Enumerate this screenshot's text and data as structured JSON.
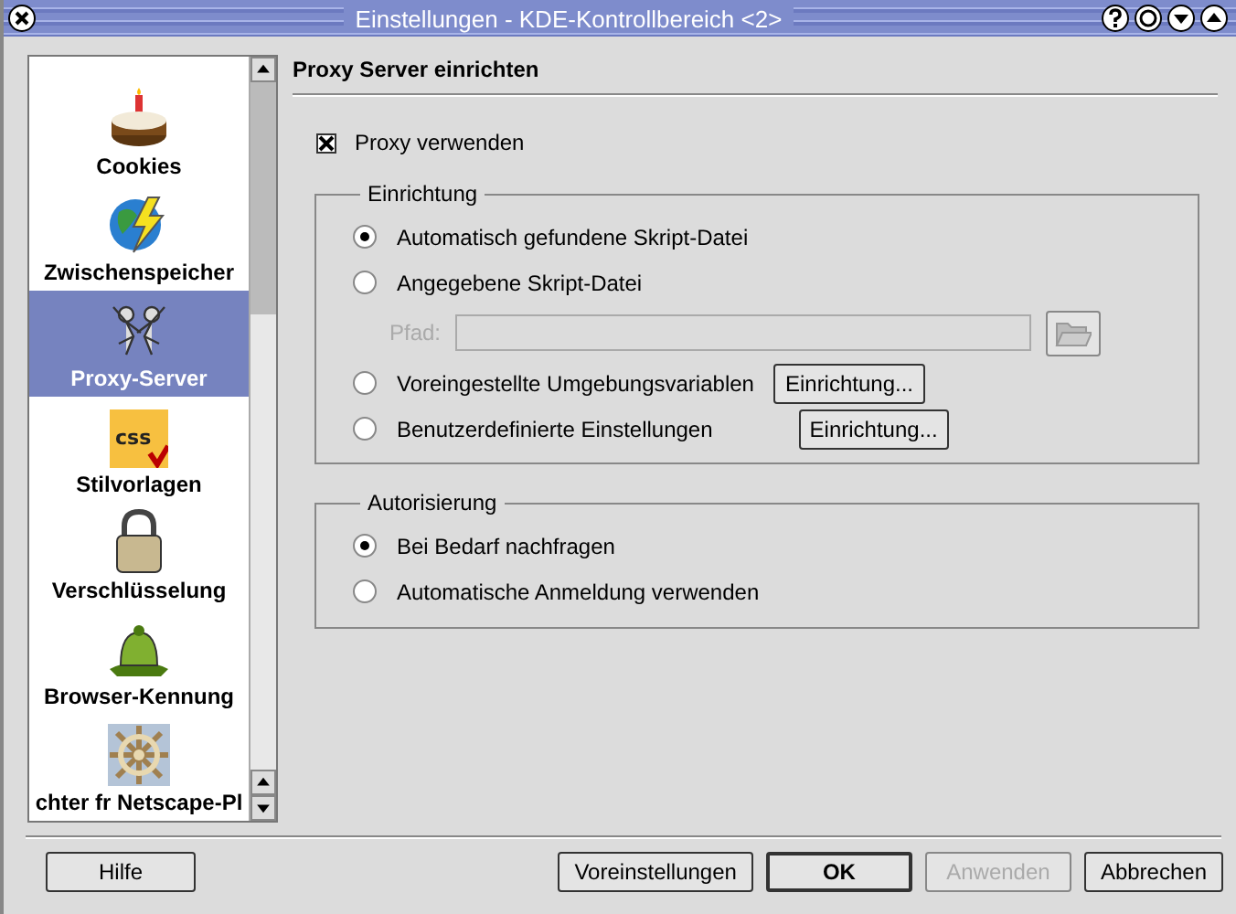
{
  "window": {
    "title": "Einstellungen - KDE-Kontrollbereich <2>"
  },
  "sidebar": {
    "items": [
      {
        "label": "Cookies",
        "selected": false
      },
      {
        "label": "Zwischenspeicher",
        "selected": false
      },
      {
        "label": "Proxy-Server",
        "selected": true
      },
      {
        "label": "Stilvorlagen",
        "selected": false,
        "icon_text": "css"
      },
      {
        "label": "Verschlüsselung",
        "selected": false
      },
      {
        "label": "Browser-Kennung",
        "selected": false
      },
      {
        "label": "chter fr Netscape-Pl",
        "selected": false
      }
    ]
  },
  "content": {
    "heading": "Proxy Server einrichten",
    "proxy_checkbox": {
      "label": "Proxy verwenden",
      "checked": true
    },
    "setup_group": {
      "title": "Einrichtung",
      "options": [
        {
          "label": "Automatisch gefundene Skript-Datei",
          "selected": true
        },
        {
          "label": "Angegebene Skript-Datei",
          "selected": false
        },
        {
          "label": "Voreingestellte Umgebungsvariablen",
          "selected": false,
          "button": "Einrichtung..."
        },
        {
          "label": "Benutzerdefinierte Einstellungen",
          "selected": false,
          "button": "Einrichtung..."
        }
      ],
      "path": {
        "label": "Pfad:",
        "disabled": true
      }
    },
    "auth_group": {
      "title": "Autorisierung",
      "options": [
        {
          "label": "Bei Bedarf nachfragen",
          "selected": true
        },
        {
          "label": "Automatische Anmeldung verwenden",
          "selected": false
        }
      ]
    }
  },
  "buttons": [
    {
      "label": "Hilfe",
      "default": false,
      "disabled": false
    },
    {
      "label": "Voreinstellungen",
      "default": false,
      "disabled": false
    },
    {
      "label": "OK",
      "default": true,
      "disabled": false
    },
    {
      "label": "Anwenden",
      "default": false,
      "disabled": true
    },
    {
      "label": "Abbrechen",
      "default": false,
      "disabled": false
    }
  ]
}
